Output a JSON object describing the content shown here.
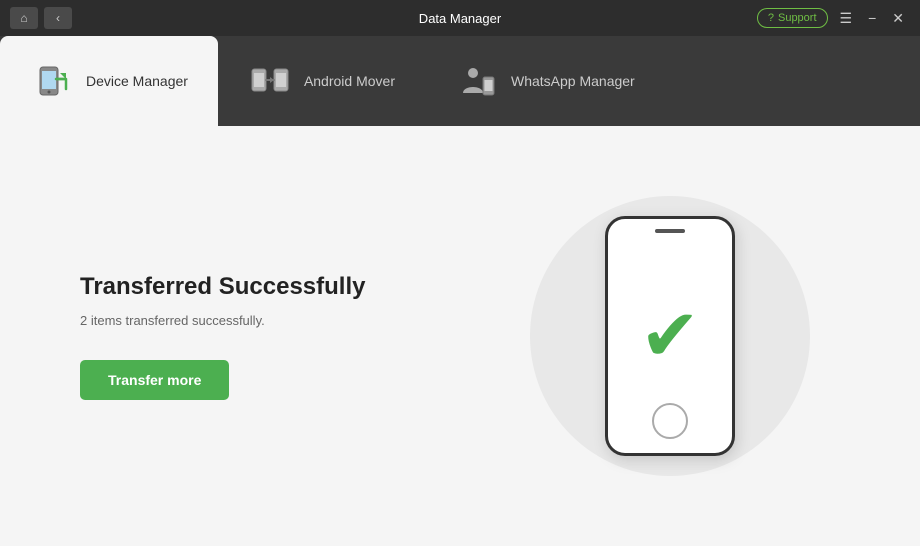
{
  "titleBar": {
    "title": "Data Manager",
    "homeBtn": "⌂",
    "backBtn": "‹",
    "support": {
      "label": "Support",
      "icon": "?"
    },
    "menuBtn": "☰",
    "minBtn": "−",
    "closeBtn": "✕"
  },
  "tabs": [
    {
      "id": "device-manager",
      "label": "Device Manager",
      "active": true
    },
    {
      "id": "android-mover",
      "label": "Android Mover",
      "active": false
    },
    {
      "id": "whatsapp-manager",
      "label": "WhatsApp Manager",
      "active": false
    }
  ],
  "content": {
    "title": "Transferred Successfully",
    "subtitle": "2 items transferred successfully.",
    "transferMoreBtn": "Transfer more"
  }
}
